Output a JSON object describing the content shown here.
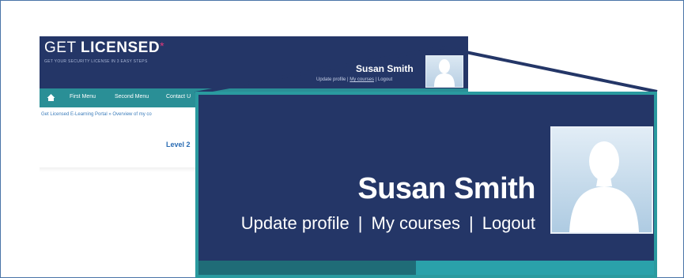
{
  "brand": {
    "logo_light": "GET",
    "logo_bold": "LICENSED",
    "logo_star": "*",
    "tagline": "GET YOUR SECURITY LICENSE IN 3 EASY STEPS"
  },
  "user": {
    "name": "Susan Smith",
    "links": [
      "Update profile",
      "My courses",
      "Logout"
    ],
    "separator": "|"
  },
  "mini": {
    "nav_items": [
      "First Menu",
      "Second Menu",
      "Contact U"
    ],
    "breadcrumb": "Get Licensed E-Learning Portal » Overview of my co",
    "level_text": "Level 2"
  },
  "colors": {
    "header": "#243667",
    "nav": "#2a8f96",
    "callout_border": "#2a9a9f",
    "frame_border": "#4a74a8"
  }
}
